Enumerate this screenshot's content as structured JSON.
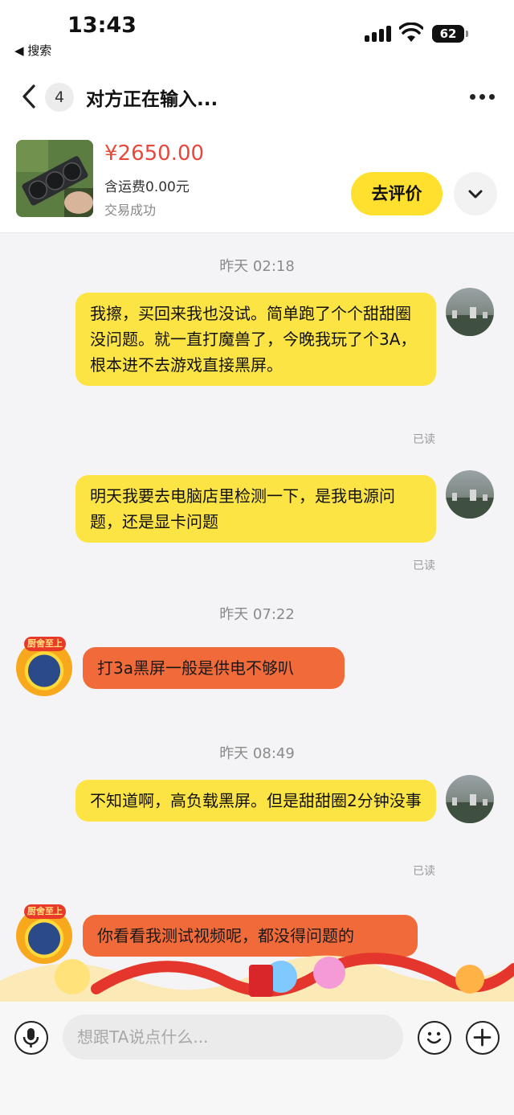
{
  "status_bar": {
    "time": "13:43",
    "back_app": "◀ 搜索",
    "battery": "62"
  },
  "nav": {
    "unread_count": "4",
    "title": "对方正在输入..."
  },
  "order": {
    "price": "¥2650.00",
    "shipping": "含运费0.00元",
    "status": "交易成功",
    "review_button": "去评价"
  },
  "messages": [
    {
      "type": "timestamp",
      "text": "昨天 02:18"
    },
    {
      "type": "me",
      "text": "我擦，买回来我也没试。简单跑了个个甜甜圈没问题。就一直打魔兽了，今晚我玩了个3A，根本进不去游戏直接黑屏。",
      "read": "已读"
    },
    {
      "type": "me",
      "text": "明天我要去电脑店里检测一下，是我电源问题，还是显卡问题",
      "read": "已读"
    },
    {
      "type": "timestamp",
      "text": "昨天 07:22"
    },
    {
      "type": "them",
      "text": "打3a黑屏一般是供电不够叭"
    },
    {
      "type": "timestamp",
      "text": "昨天 08:49"
    },
    {
      "type": "me",
      "text": "不知道啊，高负载黑屏。但是甜甜圈2分钟没事",
      "read": "已读"
    },
    {
      "type": "them",
      "text": "你看看我测试视频呢，都没得问题的"
    }
  ],
  "avatar_badge": "厨舍至上",
  "input": {
    "placeholder": "想跟TA说点什么..."
  },
  "icons": {
    "back": "chevron-left-icon",
    "more": "more-horizontal-icon",
    "expand": "chevron-down-icon",
    "mic": "microphone-icon",
    "emoji": "smiley-icon",
    "plus": "plus-icon"
  },
  "colors": {
    "accent": "#ffe02e",
    "my_bubble": "#fde445",
    "their_bubble": "#f06a3a",
    "price": "#e8483c"
  }
}
